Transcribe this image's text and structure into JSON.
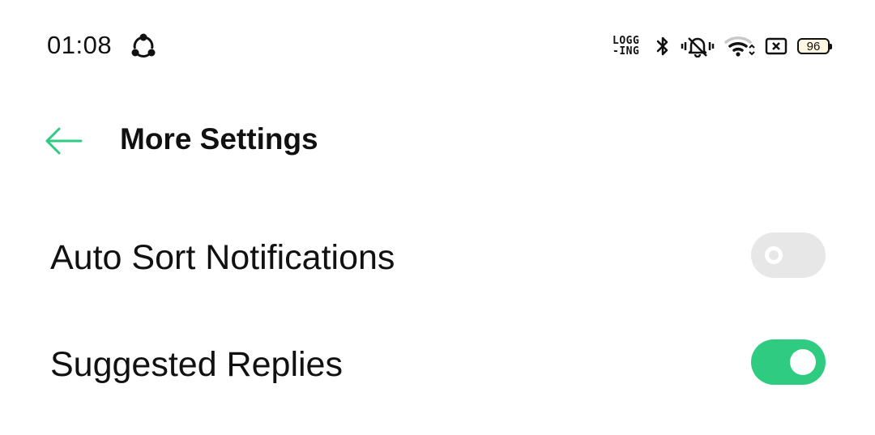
{
  "status_bar": {
    "time": "01:08",
    "logging_line1": "LOGG",
    "logging_line2": "-ING",
    "battery_level": "96",
    "icons": [
      "share-icon",
      "bluetooth-icon",
      "bell-muted-icon",
      "wifi-icon",
      "sim-x-icon",
      "battery-icon"
    ]
  },
  "header": {
    "title": "More Settings",
    "back_icon": "arrow-left-icon"
  },
  "settings": [
    {
      "label": "Auto Sort Notifications",
      "enabled": false
    },
    {
      "label": "Suggested Replies",
      "enabled": true
    }
  ],
  "colors": {
    "accent": "#2ecb80",
    "toggle_off": "#e7e7e7",
    "text": "#111111",
    "background": "#ffffff"
  }
}
